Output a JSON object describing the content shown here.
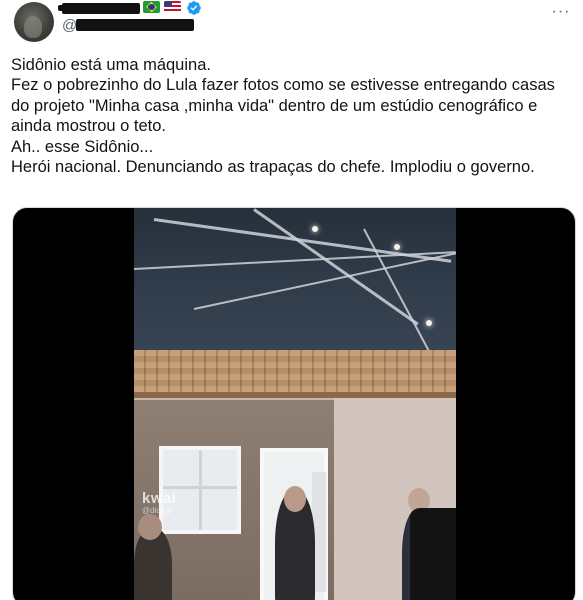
{
  "header": {
    "handle_prefix": "@",
    "icons": {
      "avatar": "avatar",
      "flag_brazil": "flag-brazil-icon",
      "flag_usa": "flag-usa-icon",
      "verified": "verified-badge-icon",
      "more": "more-options-icon"
    },
    "more_glyph": "···"
  },
  "tweet": {
    "text": "Sidônio está uma máquina.\nFez o  pobrezinho do Lula fazer fotos como se estivesse entregando casas do projeto \"Minha casa ,minha vida\" dentro de um estúdio cenográfico e ainda mostrou o teto.\nAh.. esse Sidônio...\nHerói nacional. Denunciando as trapaças do chefe. Implodiu o governo."
  },
  "media": {
    "watermark_logo": "kwai",
    "watermark_handle": "@dictop"
  },
  "colors": {
    "text": "#0f1419",
    "secondary": "#536471",
    "verified": "#1d9bf0",
    "border": "#cfd9de"
  }
}
